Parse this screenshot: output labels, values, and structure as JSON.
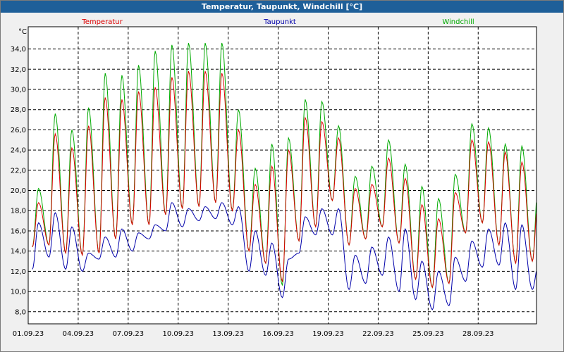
{
  "window": {
    "title": "Temperatur, Taupunkt, Windchill [°C]"
  },
  "chart_data": {
    "type": "line",
    "title": "Temperatur, Taupunkt, Windchill [°C]",
    "ylabel": "°C",
    "ylim": [
      6.8,
      36.2
    ],
    "yticks": [
      "8,0",
      "10,0",
      "12,0",
      "14,0",
      "16,0",
      "18,0",
      "20,0",
      "22,0",
      "24,0",
      "26,0",
      "28,0",
      "30,0",
      "32,0",
      "34,0"
    ],
    "xlim": [
      0,
      30.5
    ],
    "xticks": [
      {
        "x": 0,
        "label": "01.09.23"
      },
      {
        "x": 3,
        "label": "04.09.23"
      },
      {
        "x": 6,
        "label": "07.09.23"
      },
      {
        "x": 9,
        "label": "10.09.23"
      },
      {
        "x": 12,
        "label": "13.09.23"
      },
      {
        "x": 15,
        "label": "16.09.23"
      },
      {
        "x": 18,
        "label": "19.09.23"
      },
      {
        "x": 21,
        "label": "22.09.23"
      },
      {
        "x": 24,
        "label": "25.09.23"
      },
      {
        "x": 27,
        "label": "28.09.23"
      }
    ],
    "grid": true,
    "legend": "top",
    "series": [
      {
        "name": "Temperatur",
        "color": "#dd0000",
        "min": [
          14.4,
          14.6,
          13.8,
          13.6,
          13.8,
          15.2,
          16.6,
          16.6,
          17.6,
          18.2,
          18.4,
          18.8,
          18.0,
          14.0,
          12.8,
          11.0,
          15.0,
          16.4,
          19.0,
          14.6,
          15.2,
          16.4,
          14.8,
          11.2,
          10.4,
          10.8,
          15.8,
          16.8,
          14.6,
          12.8,
          13.0
        ],
        "max": [
          18.8,
          25.6,
          24.2,
          26.4,
          29.2,
          29.0,
          29.8,
          30.2,
          31.2,
          31.8,
          31.8,
          31.6,
          26.0,
          20.6,
          22.4,
          24.0,
          27.2,
          26.8,
          25.2,
          20.2,
          20.6,
          23.2,
          21.2,
          18.6,
          17.2,
          19.8,
          25.0,
          24.8,
          23.8,
          22.8,
          19.8
        ]
      },
      {
        "name": "Taupunkt",
        "color": "#0000aa",
        "min": [
          12.2,
          13.4,
          12.2,
          12.0,
          13.2,
          13.4,
          14.0,
          15.2,
          16.0,
          16.4,
          17.0,
          17.2,
          16.6,
          12.0,
          11.6,
          9.4,
          13.8,
          15.6,
          15.6,
          10.2,
          10.8,
          11.6,
          10.0,
          9.2,
          8.2,
          8.6,
          11.0,
          12.4,
          12.6,
          10.2,
          10.2
        ],
        "max": [
          16.8,
          17.8,
          16.4,
          13.8,
          15.4,
          16.2,
          15.8,
          16.6,
          18.8,
          18.2,
          18.4,
          18.8,
          18.4,
          16.0,
          14.8,
          13.2,
          17.4,
          18.2,
          18.2,
          13.6,
          14.4,
          15.4,
          16.2,
          13.0,
          12.0,
          13.4,
          15.0,
          16.2,
          16.8,
          16.6,
          12.8
        ]
      },
      {
        "name": "Windchill",
        "color": "#00aa00",
        "min": [
          14.4,
          14.6,
          13.8,
          13.6,
          13.8,
          15.2,
          16.6,
          16.6,
          17.6,
          18.2,
          18.4,
          18.8,
          18.0,
          14.0,
          12.8,
          10.6,
          15.0,
          16.4,
          19.0,
          14.6,
          15.2,
          16.4,
          14.8,
          11.2,
          10.4,
          10.8,
          15.8,
          16.8,
          14.6,
          12.8,
          13.0
        ],
        "max": [
          20.2,
          27.6,
          26.0,
          28.2,
          31.6,
          31.4,
          32.4,
          33.8,
          34.4,
          34.6,
          34.6,
          34.6,
          28.0,
          22.2,
          24.6,
          25.2,
          29.0,
          28.8,
          26.4,
          21.4,
          22.4,
          25.0,
          22.6,
          20.4,
          19.2,
          21.6,
          26.6,
          26.2,
          24.6,
          24.4,
          21.4
        ]
      }
    ]
  }
}
